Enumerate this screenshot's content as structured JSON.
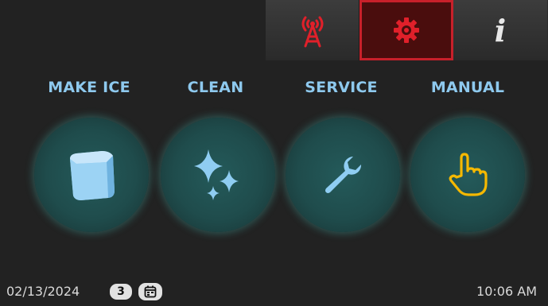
{
  "tabs": [
    {
      "icon": "antenna-icon",
      "active": false
    },
    {
      "icon": "gear-icon",
      "active": true
    },
    {
      "icon": "info-icon",
      "label": "i",
      "active": false
    }
  ],
  "actions": [
    {
      "label": "MAKE ICE",
      "icon": "ice-cube-icon"
    },
    {
      "label": "CLEAN",
      "icon": "sparkle-icon"
    },
    {
      "label": "SERVICE",
      "icon": "wrench-icon"
    },
    {
      "label": "MANUAL",
      "icon": "hand-pointer-icon"
    }
  ],
  "footer": {
    "date": "02/13/2024",
    "day_badge": "3",
    "calendar_icon": "calendar-icon",
    "time": "10:06 AM"
  },
  "colors": {
    "label": "#8ec9ee",
    "active_tab_border": "#c8202a",
    "alert_icon": "#e0202a",
    "manual_icon": "#f5b800",
    "circle_glow": "#47a8a2"
  }
}
